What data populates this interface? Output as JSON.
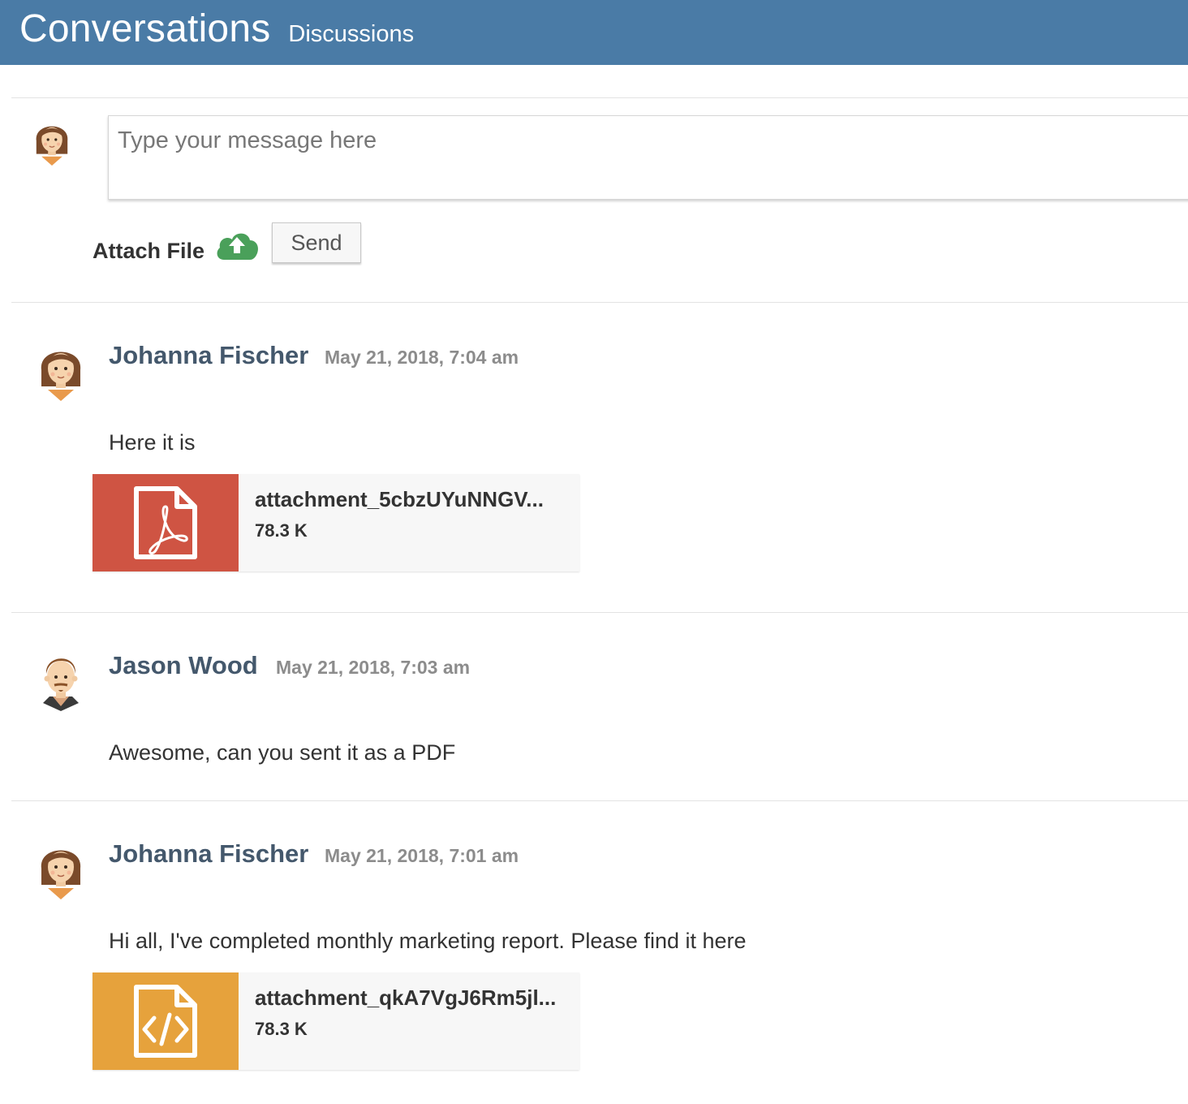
{
  "header": {
    "title": "Conversations",
    "subtitle": "Discussions"
  },
  "composer": {
    "placeholder": "Type your message here",
    "attach_label": "Attach File",
    "upload_icon": "cloud-upload-icon",
    "send_label": "Send"
  },
  "colors": {
    "header_bg": "#4a7ba6",
    "pdf_tile": "#cf5443",
    "code_tile": "#e6a23c",
    "upload_green": "#4aa05a"
  },
  "messages": [
    {
      "author": "Johanna Fischer",
      "timestamp": "May 21, 2018, 7:04 am",
      "text": "Here it is",
      "avatar": "female-avatar",
      "attachment": {
        "icon": "pdf-file-icon",
        "name": "attachment_5cbzUYuNNGV...",
        "size": "78.3 K"
      }
    },
    {
      "author": "Jason Wood",
      "timestamp": "May 21, 2018, 7:03 am",
      "text": "Awesome, can you sent it as a PDF",
      "avatar": "male-avatar"
    },
    {
      "author": "Johanna Fischer",
      "timestamp": "May 21, 2018, 7:01 am",
      "text": "Hi all, I've completed monthly marketing report. Please find it here",
      "avatar": "female-avatar",
      "attachment": {
        "icon": "code-file-icon",
        "name": "attachment_qkA7VgJ6Rm5jl...",
        "size": "78.3 K"
      }
    }
  ]
}
